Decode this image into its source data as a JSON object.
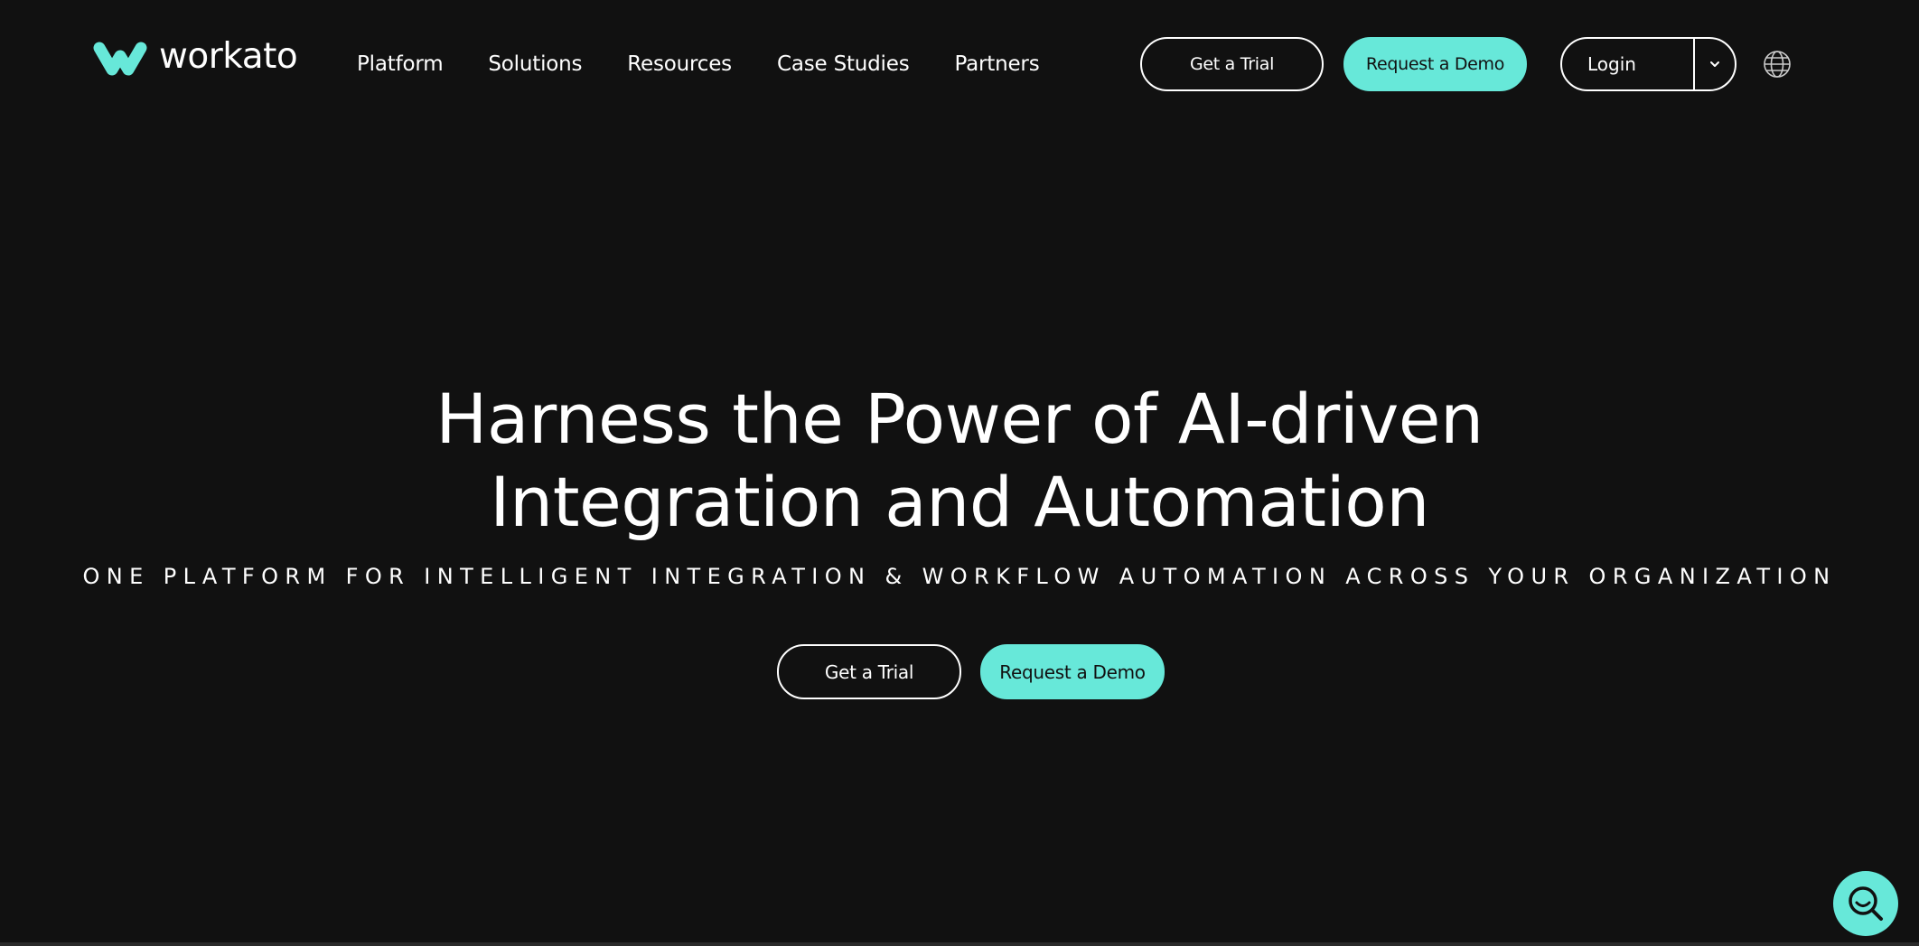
{
  "brand": {
    "name": "workato",
    "accent_color": "#67e8d9",
    "background_color": "#111111",
    "logo_icon": "workato-logo-icon"
  },
  "nav": {
    "items": [
      {
        "label": "Platform"
      },
      {
        "label": "Solutions"
      },
      {
        "label": "Resources"
      },
      {
        "label": "Case Studies"
      },
      {
        "label": "Partners"
      }
    ]
  },
  "header_actions": {
    "trial_label": "Get a Trial",
    "demo_label": "Request a Demo",
    "login_label": "Login",
    "login_menu_icon": "chevron-down-icon",
    "language_icon": "globe-icon"
  },
  "hero": {
    "title": "Harness the Power of AI-driven Integration and Automation",
    "subtitle": "ONE PLATFORM FOR INTELLIGENT INTEGRATION & WORKFLOW AUTOMATION ACROSS YOUR ORGANIZATION",
    "trial_label": "Get a Trial",
    "demo_label": "Request a Demo"
  },
  "floating": {
    "search_icon": "search-icon"
  }
}
